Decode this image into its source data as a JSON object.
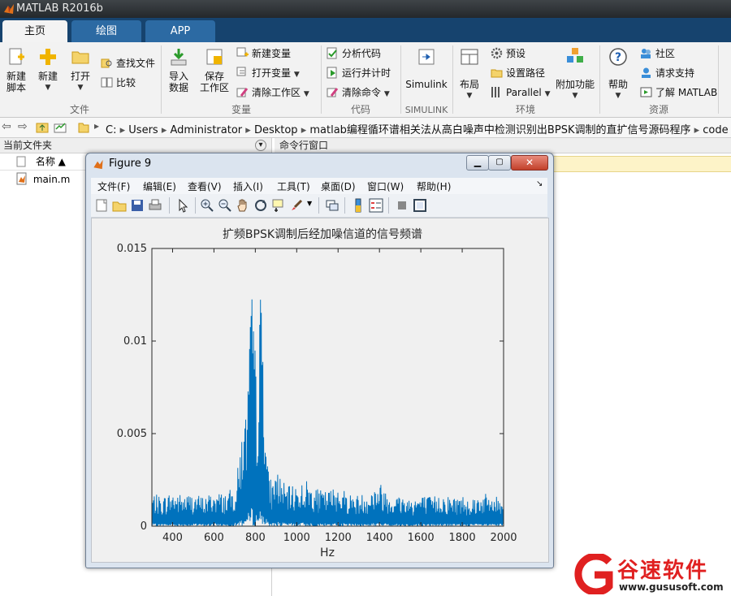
{
  "window": {
    "title": "MATLAB R2016b"
  },
  "tabs": [
    {
      "label": "主页"
    },
    {
      "label": "绘图"
    },
    {
      "label": "APP"
    }
  ],
  "ribbon": {
    "file": {
      "section_label": "文件",
      "new_script": [
        "新建",
        "脚本"
      ],
      "new": "新建",
      "open": "打开",
      "find_files": "查找文件",
      "compare": "比较"
    },
    "variable": {
      "section_label": "变量",
      "import_data": [
        "导入",
        "数据"
      ],
      "save_workspace": [
        "保存",
        "工作区"
      ],
      "new_variable": "新建变量",
      "open_variable": "打开变量",
      "clear_workspace": "清除工作区"
    },
    "code": {
      "section_label": "代码",
      "analyze_code": "分析代码",
      "run_and_time": "运行并计时",
      "clear_commands": "清除命令"
    },
    "simulink": {
      "section_label": "SIMULINK",
      "simulink": "Simulink"
    },
    "environment": {
      "section_label": "环境",
      "layout": "布局",
      "preferences": "预设",
      "set_path": "设置路径",
      "parallel": "Parallel",
      "add_ons": "附加功能"
    },
    "resources": {
      "section_label": "资源",
      "help": "帮助",
      "community": "社区",
      "request_support": "请求支持",
      "learn_matlab": "了解 MATLAB"
    }
  },
  "address": {
    "path": [
      "C:",
      "Users",
      "Administrator",
      "Desktop",
      "matlab编程循环谱相关法从高白噪声中检测识别出BPSK调制的直扩信号源码程序",
      "code"
    ]
  },
  "left_panel": {
    "title": "当前文件夹",
    "column_name": "名称 ▲",
    "files": [
      {
        "name": "main.m"
      }
    ]
  },
  "command_panel": {
    "title": "命令行窗口"
  },
  "figure": {
    "title": "Figure 9",
    "menu": [
      "文件(F)",
      "编辑(E)",
      "查看(V)",
      "插入(I)",
      "工具(T)",
      "桌面(D)",
      "窗口(W)",
      "帮助(H)"
    ]
  },
  "chart_data": {
    "type": "line",
    "title": "扩频BPSK调制后经加噪信道的信号频谱",
    "xlabel": "Hz",
    "ylabel": "",
    "xlim": [
      300,
      2000
    ],
    "ylim": [
      0,
      0.015
    ],
    "xticks": [
      400,
      600,
      800,
      1000,
      1200,
      1400,
      1600,
      1800,
      2000
    ],
    "yticks": [
      0,
      0.005,
      0.01,
      0.015
    ],
    "ytick_labels": [
      "0",
      "0.005",
      "0.01",
      "0.015"
    ],
    "grid": false,
    "color": "#0072bd",
    "series": [
      {
        "x": [
          300,
          350,
          400,
          450,
          500,
          550,
          600,
          650,
          700,
          720,
          740,
          750,
          760,
          770,
          780,
          790,
          800,
          810,
          820,
          830,
          840,
          850,
          860,
          880,
          900,
          950,
          1000,
          1050,
          1100,
          1150,
          1200,
          1250,
          1300,
          1350,
          1400,
          1450,
          1500,
          1550,
          1600,
          1650,
          1700,
          1750,
          1800,
          1850,
          1900,
          1950,
          2000
        ],
        "y": [
          0.0018,
          0.0016,
          0.0019,
          0.0017,
          0.0018,
          0.0016,
          0.0019,
          0.0018,
          0.0021,
          0.0035,
          0.0062,
          0.0058,
          0.0074,
          0.0098,
          0.0124,
          0.0135,
          0.0092,
          0.0082,
          0.0126,
          0.0131,
          0.0118,
          0.0058,
          0.0032,
          0.0024,
          0.0032,
          0.0021,
          0.0023,
          0.0025,
          0.002,
          0.0019,
          0.0023,
          0.0018,
          0.0017,
          0.0019,
          0.0024,
          0.0018,
          0.0017,
          0.0016,
          0.0017,
          0.0016,
          0.0018,
          0.0016,
          0.0017,
          0.0016,
          0.0018,
          0.0016,
          0.0017
        ]
      }
    ]
  },
  "watermark": {
    "brand": "谷速软件",
    "url": "www.gususoft.com",
    "color": "#e02020"
  }
}
